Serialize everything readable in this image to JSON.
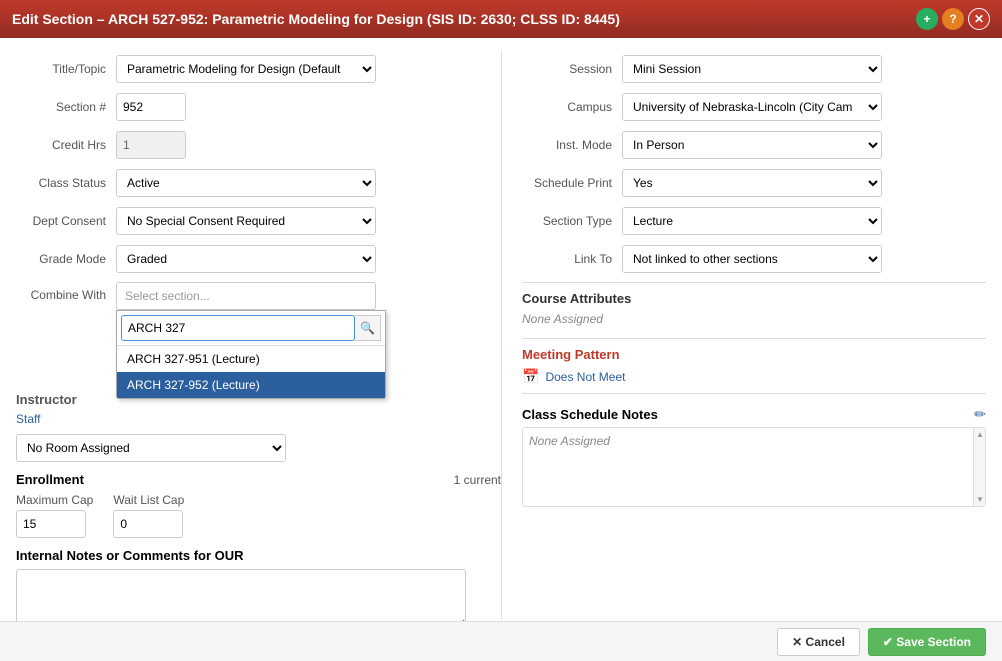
{
  "titleBar": {
    "title": "Edit Section – ARCH 527-952: Parametric Modeling for Design (SIS ID: 2630; CLSS ID: 8445)",
    "plusIcon": "+",
    "questionIcon": "?",
    "closeIcon": "✕"
  },
  "leftForm": {
    "titleTopicLabel": "Title/Topic",
    "titleTopicValue": "Parametric Modeling for Design (Default",
    "sectionNumLabel": "Section #",
    "sectionNumValue": "952",
    "creditHrsLabel": "Credit Hrs",
    "creditHrsValue": "1",
    "classStatusLabel": "Class Status",
    "classStatusValue": "Active",
    "deptConsentLabel": "Dept Consent",
    "deptConsentValue": "No Special Consent Required",
    "gradeModeLabel": "Grade Mode",
    "gradeModeValue": "Graded",
    "combineWithLabel": "Combine With",
    "combineWithPlaceholder": "Select section...",
    "searchValue": "ARCH 327",
    "dropdownItems": [
      {
        "label": "ARCH 327-951 (Lecture)",
        "selected": false
      },
      {
        "label": "ARCH 327-952 (Lecture)",
        "selected": true
      }
    ]
  },
  "rightForm": {
    "sessionLabel": "Session",
    "sessionValue": "Mini Session",
    "campusLabel": "Campus",
    "campusValue": "University of Nebraska-Lincoln (City Cam",
    "instModeLabel": "Inst. Mode",
    "instModeValue": "In Person",
    "schedulePrintLabel": "Schedule Print",
    "schedulePrintValue": "Yes",
    "sectionTypeLabel": "Section Type",
    "sectionTypeValue": "Lecture",
    "linkToLabel": "Link To",
    "linkToValue": "Not linked to other sections"
  },
  "instructorSection": {
    "title": "Instructor",
    "staffLabel": "Staff"
  },
  "roomRow": {
    "value": "No Room Assigned"
  },
  "meetingPattern": {
    "title": "Meeting Pattern",
    "doesNotMeet": "Does Not Meet"
  },
  "courseAttributes": {
    "title": "Course Attributes",
    "noneAssigned": "None Assigned"
  },
  "classScheduleNotes": {
    "title": "Class Schedule Notes",
    "noneAssigned": "None Assigned",
    "editIcon": "✏"
  },
  "enrollment": {
    "title": "Enrollment",
    "currentLabel": "1 current",
    "maximumCapLabel": "Maximum Cap",
    "maximumCapValue": "15",
    "waitListCapLabel": "Wait List Cap",
    "waitListCapValue": "0"
  },
  "internalNotes": {
    "title": "Internal Notes or Comments for OUR"
  },
  "footer": {
    "cancelLabel": "✕ Cancel",
    "saveLabel": "✔ Save Section"
  }
}
